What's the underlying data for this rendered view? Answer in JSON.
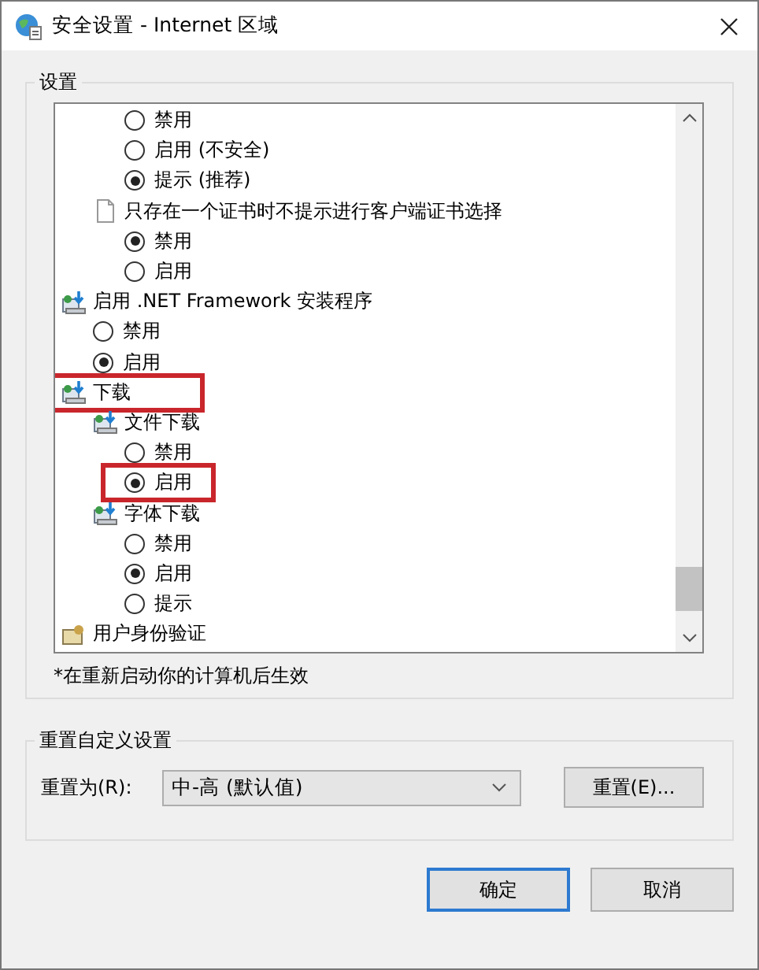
{
  "window": {
    "title": "安全设置 - Internet 区域"
  },
  "settings_group": {
    "title": "设置",
    "note": "*在重新启动你的计算机后生效"
  },
  "tree": [
    {
      "kind": "category-continued",
      "children": [
        {
          "kind": "setting-continued",
          "children": [
            {
              "kind": "radio",
              "label": "禁用",
              "selected": false,
              "highlighted": false
            },
            {
              "kind": "radio",
              "label": "启用 (不安全)",
              "selected": false,
              "highlighted": false
            },
            {
              "kind": "radio",
              "label": "提示 (推荐)",
              "selected": true,
              "highlighted": false
            }
          ]
        },
        {
          "kind": "setting-document",
          "label": "只存在一个证书时不提示进行客户端证书选择",
          "highlighted": false,
          "children": [
            {
              "kind": "radio",
              "label": "禁用",
              "selected": true,
              "highlighted": false
            },
            {
              "kind": "radio",
              "label": "启用",
              "selected": false,
              "highlighted": false
            }
          ]
        }
      ]
    },
    {
      "kind": "category-program",
      "label": "启用 .NET Framework 安装程序",
      "highlighted": false,
      "children": [
        {
          "kind": "radio",
          "label": "禁用",
          "selected": false,
          "highlighted": false
        },
        {
          "kind": "radio",
          "label": "启用",
          "selected": true,
          "highlighted": false
        }
      ]
    },
    {
      "kind": "category-program",
      "label": "下载",
      "highlighted": true,
      "children": [
        {
          "kind": "setting-program",
          "label": "文件下载",
          "highlighted": false,
          "children": [
            {
              "kind": "radio",
              "label": "禁用",
              "selected": false,
              "highlighted": false
            },
            {
              "kind": "radio",
              "label": "启用",
              "selected": true,
              "highlighted": true
            }
          ]
        },
        {
          "kind": "setting-program",
          "label": "字体下载",
          "highlighted": false,
          "children": [
            {
              "kind": "radio",
              "label": "禁用",
              "selected": false,
              "highlighted": false
            },
            {
              "kind": "radio",
              "label": "启用",
              "selected": true,
              "highlighted": false
            },
            {
              "kind": "radio",
              "label": "提示",
              "selected": false,
              "highlighted": false
            }
          ]
        }
      ]
    },
    {
      "kind": "category-user",
      "label": "用户身份验证",
      "highlighted": false
    }
  ],
  "reset_group": {
    "title": "重置自定义设置",
    "label": "重置为(R):",
    "value": "中-高 (默认值)",
    "button": "重置(E)..."
  },
  "buttons": [
    {
      "label": "确定",
      "default": true
    },
    {
      "label": "取消",
      "default": false
    }
  ]
}
